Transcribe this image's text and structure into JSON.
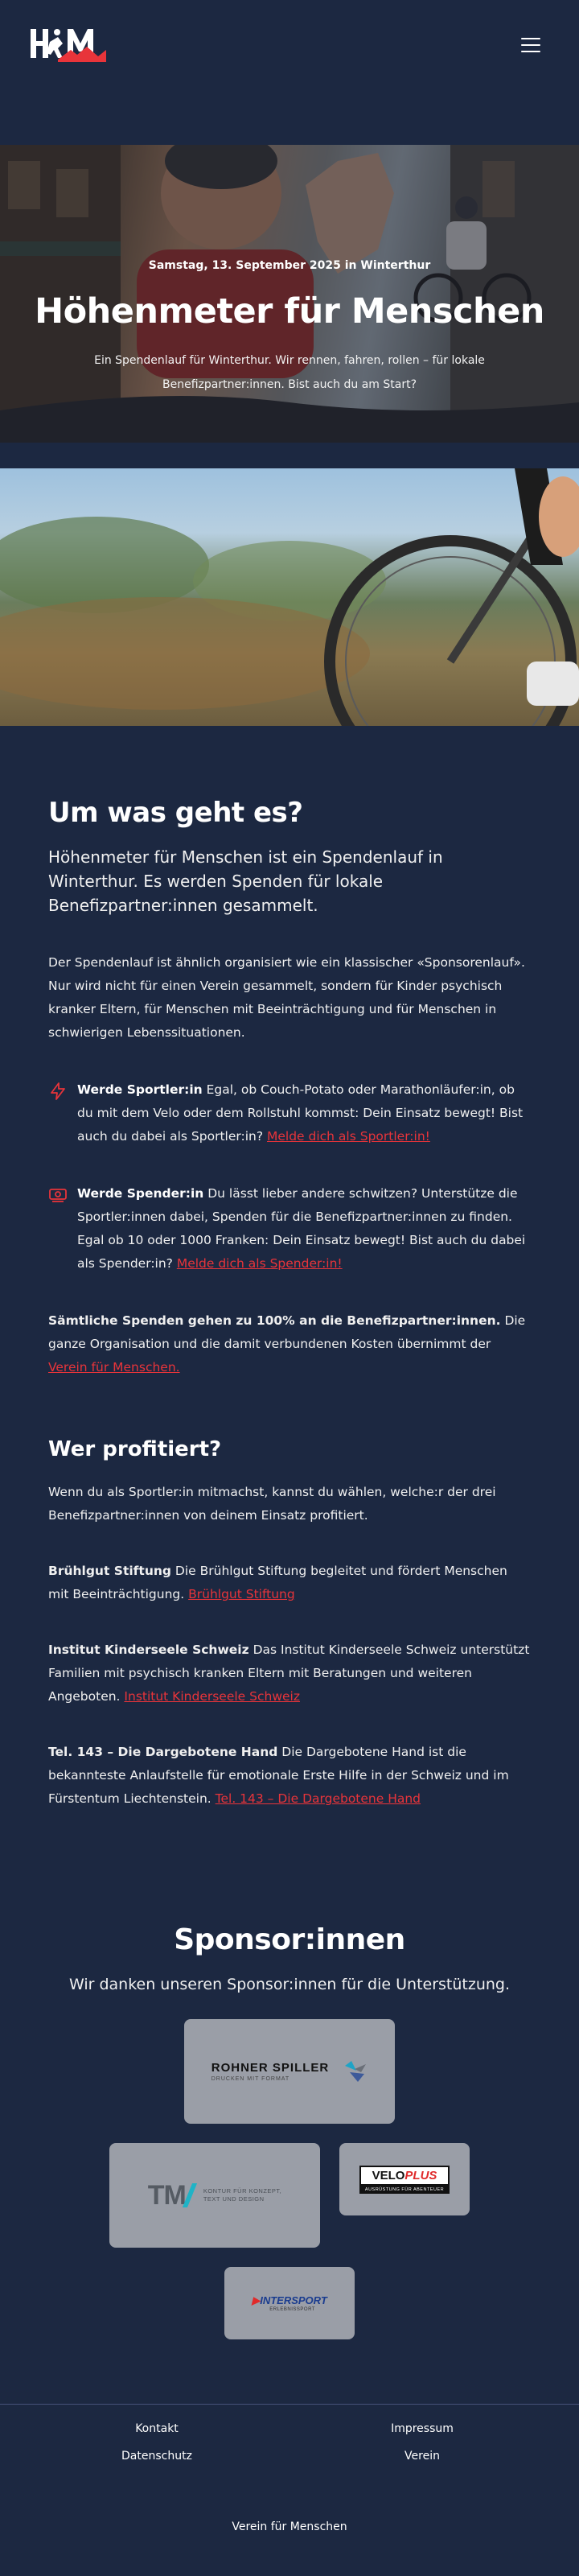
{
  "colors": {
    "background": "#1c2841",
    "accent": "#e8343a",
    "sponsor_card": "#9a9ea7"
  },
  "header": {
    "logo_alt": "HfM",
    "menu_icon": "hamburger-icon"
  },
  "hero": {
    "date": "Samstag, 13. September 2025 in Winterthur",
    "title": "Höhenmeter für Menschen",
    "lead": "Ein Spendenlauf für Winterthur. Wir rennen, fahren, rollen – für lokale Benefizpartner:innen. Bist auch du am Start?"
  },
  "about": {
    "heading": "Um was geht es?",
    "intro": "Höhenmeter für Menschen ist ein Spendenlauf in Winterthur. Es werden Spenden für lokale Benefizpartner:innen gesammelt.",
    "text": "Der Spendenlauf ist ähnlich organisiert wie ein klassischer «Sponsorenlauf». Nur wird nicht für einen Verein gesammelt, sondern für Kinder psychisch kranker Eltern, für Menschen mit Beeinträchtigung und für Menschen in schwierigen Lebenssituationen.",
    "features": [
      {
        "icon": "lightning-icon",
        "title": "Werde Sportler:in",
        "text": " Egal, ob Couch-Potato oder Marathonläufer:in, ob du mit dem Velo oder dem Rollstuhl kommst: Dein Einsatz bewegt! Bist auch du dabei als Sportler:in? ",
        "link": "Melde dich als Sportler:in!"
      },
      {
        "icon": "money-icon",
        "title": "Werde Spender:in",
        "text": " Du lässt lieber andere schwitzen? Unterstütze die Sportler:innen dabei, Spenden für die Benefizpartner:innen zu finden. Egal ob 10 oder 1000 Franken: Dein Einsatz bewegt! Bist auch du dabei als Spender:in? ",
        "link": "Melde dich als Spender:in!"
      }
    ],
    "donations_bold": "Sämtliche Spenden gehen zu 100% an die Benefizpartner:innen.",
    "donations_text": " Die ganze Organisation und die damit verbundenen Kosten übernimmt der ",
    "donations_link": "Verein für Menschen."
  },
  "beneficiaries": {
    "heading": "Wer profitiert?",
    "intro": "Wenn du als Sportler:in mitmachst, kannst du wählen, welche:r der drei Benefizpartner:innen von deinem Einsatz profitiert.",
    "items": [
      {
        "name": "Brühlgut Stiftung",
        "text": " Die Brühlgut Stiftung begleitet und fördert Menschen mit Beeinträchtigung. ",
        "link": "Brühlgut Stiftung"
      },
      {
        "name": "Institut Kinderseele Schweiz",
        "text": " Das Institut Kinderseele Schweiz unterstützt Familien mit psychisch kranken Eltern mit Beratungen und weiteren Angeboten. ",
        "link": "Institut Kinderseele Schweiz"
      },
      {
        "name": "Tel. 143 – Die Dargebotene Hand",
        "text": " Die Dargebotene Hand ist die bekannteste Anlaufstelle für emotionale Erste Hilfe in der Schweiz und im Fürstentum Liechtenstein. ",
        "link": "Tel. 143 – Die Dargebotene Hand"
      }
    ]
  },
  "sponsors": {
    "heading": "Sponsor:innen",
    "subtitle": "Wir danken unseren Sponsor:innen für die Unterstützung.",
    "rohner": {
      "name": "ROHNER SPILLER",
      "tagline": "DRUCKEN MIT FORMAT"
    },
    "tm": {
      "mark": "TM",
      "line1": "KONTUR FÜR KONZEPT,",
      "line2": "TEXT UND DESIGN"
    },
    "velo": {
      "part1": "VELO",
      "part2": "PLUS",
      "tagline": "AUSRÜSTUNG FÜR ABENTEUER"
    },
    "intersport": {
      "mark": "▶",
      "name": "INTERSPORT",
      "sub": "ERLEBNISSPORT"
    }
  },
  "footer": {
    "links": [
      "Kontakt",
      "Impressum",
      "Datenschutz",
      "Verein"
    ],
    "copyright": "Verein für Menschen"
  }
}
